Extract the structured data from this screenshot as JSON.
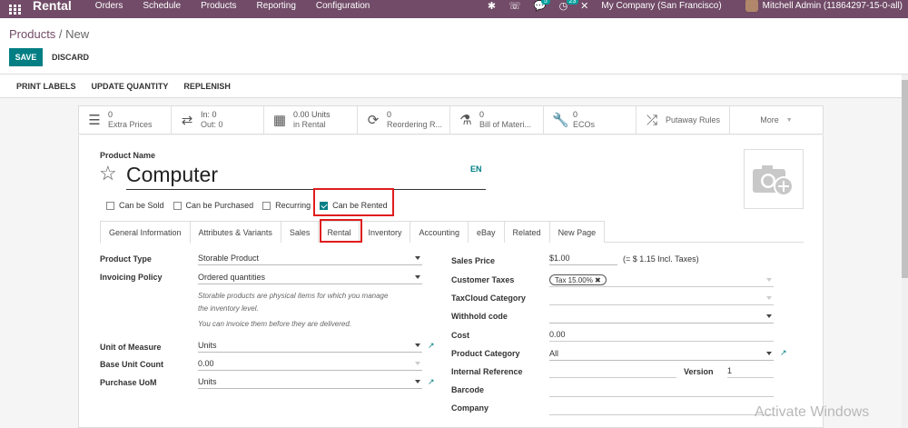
{
  "navbar": {
    "app_name": "Rental",
    "menu": [
      "Orders",
      "Schedule",
      "Products",
      "Reporting",
      "Configuration"
    ],
    "messages_badge": "5",
    "activities_badge": "23",
    "company": "My Company (San Francisco)",
    "user": "Mitchell Admin (11864297-15-0-all)"
  },
  "breadcrumb": {
    "parent": "Products",
    "separator": " / ",
    "current": "New"
  },
  "buttons": {
    "save": "SAVE",
    "discard": "DISCARD"
  },
  "status_buttons": [
    "PRINT LABELS",
    "UPDATE QUANTITY",
    "REPLENISH"
  ],
  "smart_buttons": [
    {
      "icon": "list-icon",
      "value": "0",
      "label": "Extra Prices"
    },
    {
      "icon": "transfer-icon",
      "value": "In:    0",
      "label": "Out:  0"
    },
    {
      "icon": "calendar-icon",
      "value": "0.00 Units",
      "label": "in Rental"
    },
    {
      "icon": "refresh-icon",
      "value": "0",
      "label": "Reordering R..."
    },
    {
      "icon": "flask-icon",
      "value": "0",
      "label": "Bill of Materi..."
    },
    {
      "icon": "wrench-icon",
      "value": "0",
      "label": "ECOs"
    },
    {
      "icon": "shuffle-icon",
      "value": "",
      "label": "Putaway Rules"
    },
    {
      "icon": "",
      "value": "",
      "label": "More"
    }
  ],
  "product": {
    "name_label": "Product Name",
    "name": "Computer",
    "lang": "EN"
  },
  "checkboxes": [
    {
      "label": "Can be Sold",
      "checked": false
    },
    {
      "label": "Can be Purchased",
      "checked": false
    },
    {
      "label": "Recurring",
      "checked": false
    },
    {
      "label": "Can be Rented",
      "checked": true
    }
  ],
  "tabs": [
    "General Information",
    "Attributes & Variants",
    "Sales",
    "Rental",
    "Inventory",
    "Accounting",
    "eBay",
    "Related",
    "New Page"
  ],
  "left_fields": {
    "product_type_label": "Product Type",
    "product_type_value": "Storable Product",
    "invoicing_policy_label": "Invoicing Policy",
    "invoicing_policy_value": "Ordered quantities",
    "help1": "Storable products are physical items for which you manage",
    "help2": "the inventory level.",
    "help3": "You can invoice them before they are delivered.",
    "uom_label": "Unit of Measure",
    "uom_value": "Units",
    "base_unit_label": "Base Unit Count",
    "base_unit_value": "0.00",
    "purchase_uom_label": "Purchase UoM",
    "purchase_uom_value": "Units"
  },
  "right_fields": {
    "sales_price_label": "Sales Price",
    "sales_price_value": "$1.00",
    "sales_price_incl": "(= $ 1.15 Incl. Taxes)",
    "customer_taxes_label": "Customer Taxes",
    "customer_taxes_tag": "Tax 15.00% ✖",
    "taxcloud_label": "TaxCloud Category",
    "withhold_label": "Withhold code",
    "cost_label": "Cost",
    "cost_value": "0.00",
    "category_label": "Product Category",
    "category_value": "All",
    "internal_ref_label": "Internal Reference",
    "version_label": "Version",
    "version_value": "1",
    "barcode_label": "Barcode",
    "company_label": "Company"
  },
  "watermark": "Activate Windows",
  "colors": {
    "navbar": "#714b67",
    "primary": "#017e84",
    "highlight": "#e01d1d"
  }
}
